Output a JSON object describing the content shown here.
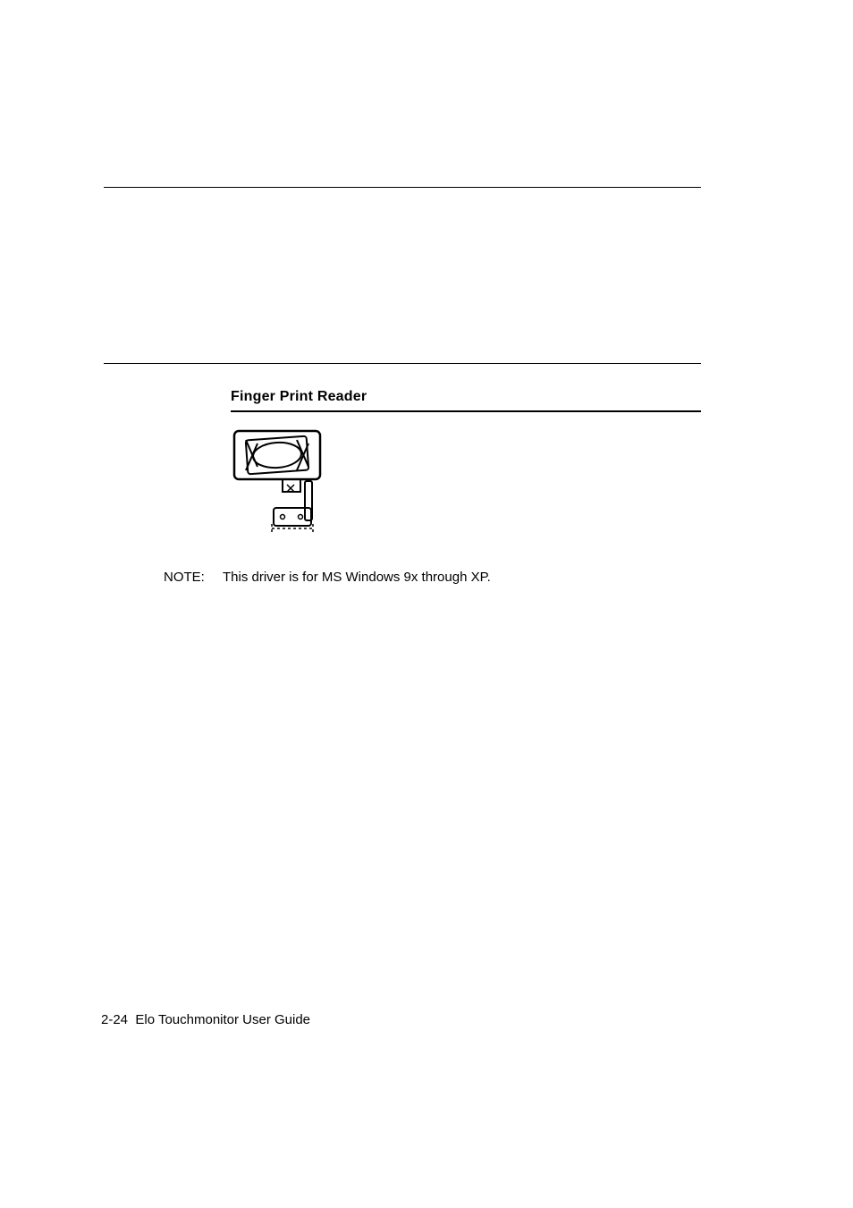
{
  "section": {
    "heading": "Finger Print Reader"
  },
  "note": {
    "label": "NOTE:",
    "text": "This driver is for MS Windows 9x through XP."
  },
  "footer": {
    "page_number": "2-24",
    "doc_title": "Elo Touchmonitor User Guide"
  }
}
